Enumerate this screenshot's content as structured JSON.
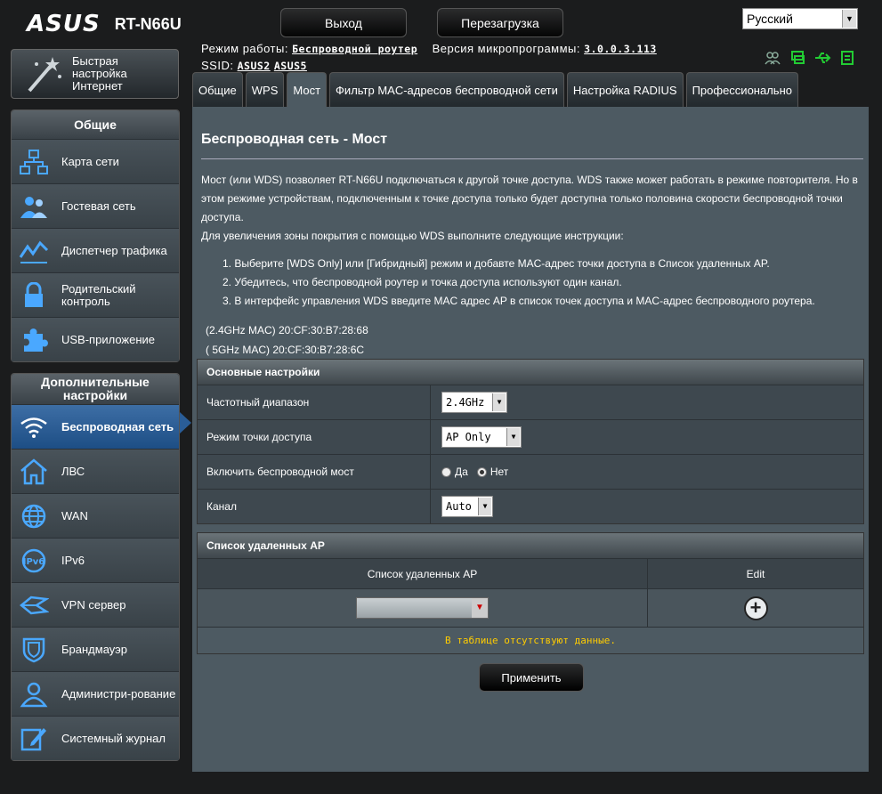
{
  "header": {
    "logo_text": "ASUS",
    "model": "RT-N66U",
    "logout_label": "Выход",
    "reboot_label": "Перезагрузка",
    "language": "Русский",
    "mode_label": "Режим работы:",
    "mode_value": "Беспроводной роутер",
    "firmware_label": "Версия микропрограммы:",
    "firmware_value": "3.0.0.3.113",
    "ssid_label": "SSID:",
    "ssid_1": "ASUS2",
    "ssid_2": "ASUS5",
    "status_icons": [
      "clients-icon",
      "network-status-icon",
      "usb-icon",
      "printer-icon"
    ]
  },
  "quick_setup": {
    "label": "Быстрая настройка Интернет"
  },
  "sidebar": {
    "general_title": "Общие",
    "general_items": [
      {
        "label": "Карта сети",
        "icon": "network-map-icon"
      },
      {
        "label": "Гостевая сеть",
        "icon": "guest-network-icon"
      },
      {
        "label": "Диспетчер трафика",
        "icon": "traffic-manager-icon"
      },
      {
        "label": "Родительский контроль",
        "icon": "lock-icon"
      },
      {
        "label": "USB-приложение",
        "icon": "puzzle-icon"
      }
    ],
    "advanced_title": "Дополнительные настройки",
    "advanced_items": [
      {
        "label": "Беспроводная сеть",
        "icon": "wifi-icon"
      },
      {
        "label": "ЛВС",
        "icon": "home-icon"
      },
      {
        "label": "WAN",
        "icon": "globe-icon"
      },
      {
        "label": "IPv6",
        "icon": "ipv6-icon"
      },
      {
        "label": "VPN сервер",
        "icon": "vpn-icon"
      },
      {
        "label": "Брандмауэр",
        "icon": "shield-icon"
      },
      {
        "label": "Администри-рование",
        "icon": "admin-user-icon"
      },
      {
        "label": "Системный журнал",
        "icon": "log-edit-icon"
      }
    ]
  },
  "tabs": [
    "Общие",
    "WPS",
    "Мост",
    "Фильтр MAC-адресов беспроводной сети",
    "Настройка RADIUS",
    "Профессионально"
  ],
  "main": {
    "title": "Беспроводная сеть - Мост",
    "desc_1": "Мост (или WDS) позволяет RT-N66U подключаться к другой точке доступа. WDS также может работать в режиме повторителя. Но в этом режиме устройствам, подключенным к точке доступа только будет доступна только половина скорости беспроводной точки доступа.",
    "desc_2": "Для увеличения зоны покрытия с помощью WDS выполните следующие инструкции:",
    "steps": [
      "1.  Выберите [WDS Only] или [Гибридный] режим и добавте MAC-адрес точки доступа в Список удаленных AP.",
      "2.  Убедитесь, что беспроводной роутер и точка доступа используют один канал.",
      "3.  В интерфейс управления WDS введите MAC адрес AP в список точек доступа и MAC-адрес беспроводного роутера."
    ],
    "mac_24": "(2.4GHz MAC) 20:CF:30:B7:28:68",
    "mac_5": "( 5GHz MAC) 20:CF:30:B7:28:6C",
    "basic_title": "Основные настройки",
    "band_label": "Частотный диапазон",
    "band_value": "2.4GHz",
    "ap_mode_label": "Режим точки доступа",
    "ap_mode_value": "AP Only",
    "bridge_label": "Включить беспроводной мост",
    "bridge_yes": "Да",
    "bridge_no": "Нет",
    "channel_label": "Канал",
    "channel_value": "Auto",
    "remote_title": "Список удаленных AP",
    "remote_col": "Список удаленных AP",
    "edit_col": "Edit",
    "empty_text": "В таблице отсутствуют данные.",
    "apply_label": "Применить"
  }
}
